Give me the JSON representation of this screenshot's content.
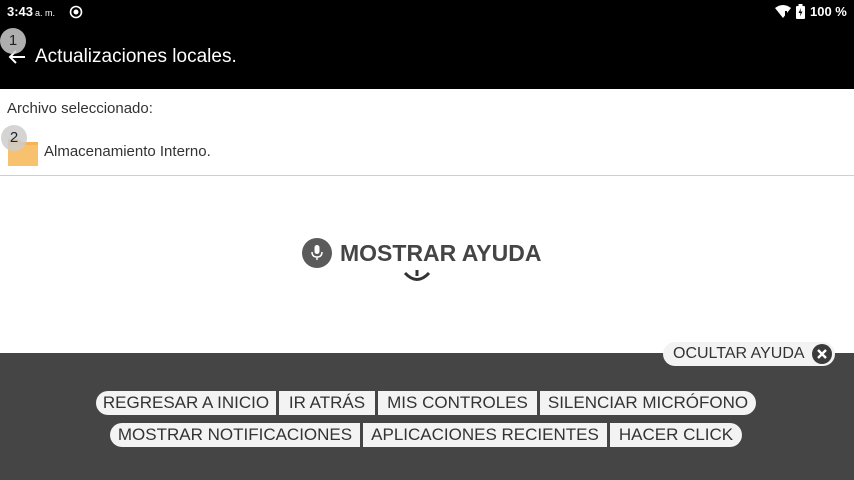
{
  "status_bar": {
    "time": "3:43",
    "ampm": "a. m.",
    "battery_percent": "100 %",
    "icons": [
      "sync-icon",
      "wifi-icon",
      "battery-icon"
    ]
  },
  "app_bar": {
    "back_icon": "arrow-back-icon",
    "title": "Actualizaciones locales."
  },
  "badges": [
    "1",
    "2"
  ],
  "file_section": {
    "label": "Archivo seleccionado:",
    "file_icon": "folder-icon",
    "file_name": "Almacenamiento Interno."
  },
  "voice_help": {
    "icon": "microphone-icon",
    "label": "MOSTRAR AYUDA"
  },
  "voice_commands": {
    "hide_help": "OCULTAR AYUDA",
    "hide_icon": "close-circle-icon",
    "row1": [
      "REGRESAR A INICIO",
      "IR ATRÁS",
      "MIS CONTROLES",
      "SILENCIAR MICRÓFONO"
    ],
    "row2": [
      "MOSTRAR NOTIFICACIONES",
      "APLICACIONES RECIENTES",
      "HACER CLICK"
    ]
  },
  "colors": {
    "bar_background": "#000000",
    "overlay_background": "#454545",
    "pill_background": "#f3f3f3",
    "folder": "#f6b454"
  }
}
